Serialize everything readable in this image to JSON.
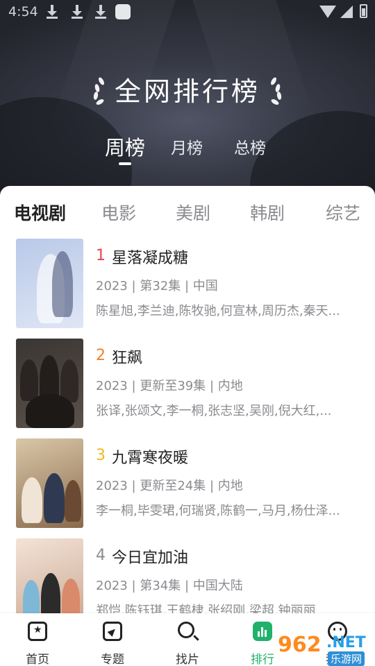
{
  "status_bar": {
    "time": "4:54"
  },
  "header": {
    "title": "全网排行榜",
    "period_tabs": [
      {
        "label": "周榜",
        "active": true
      },
      {
        "label": "月榜",
        "active": false
      },
      {
        "label": "总榜",
        "active": false
      }
    ]
  },
  "category_tabs": [
    {
      "label": "电视剧",
      "active": true
    },
    {
      "label": "电影",
      "active": false
    },
    {
      "label": "美剧",
      "active": false
    },
    {
      "label": "韩剧",
      "active": false
    },
    {
      "label": "综艺",
      "active": false
    }
  ],
  "items": [
    {
      "rank": "1",
      "rank_color": "#e8434a",
      "title": "星落凝成糖",
      "meta": "2023 | 第32集 | 中国",
      "cast": "陈星旭,李兰迪,陈牧驰,何宣林,周历杰,秦天...",
      "poster_colors": [
        "#b9c9e8",
        "#dfe6f5"
      ]
    },
    {
      "rank": "2",
      "rank_color": "#f0822c",
      "title": "狂飙",
      "meta": "2023 | 更新至39集 | 内地",
      "cast": "张译,张颂文,李一桐,张志坚,吴刚,倪大红,...",
      "poster_colors": [
        "#3a3633",
        "#5b514a"
      ]
    },
    {
      "rank": "3",
      "rank_color": "#f4b81c",
      "title": "九霄寒夜暖",
      "meta": "2023 | 更新至24集 | 内地",
      "cast": "李一桐,毕雯珺,何瑞贤,陈鹤一,马月,杨仕泽...",
      "poster_colors": [
        "#d9c7a8",
        "#8a6a4c"
      ]
    },
    {
      "rank": "4",
      "rank_color": "#8a8b8f",
      "title": "今日宜加油",
      "meta": "2023 | 第34集 | 中国大陆",
      "cast": "郑恺,陈钰琪,王鹤棣,张绍刚,梁超,钟丽丽",
      "poster_colors": [
        "#f3e3d8",
        "#c9a68f"
      ]
    }
  ],
  "bottom_nav": [
    {
      "label": "首页",
      "icon": "home-icon",
      "active": false
    },
    {
      "label": "专题",
      "icon": "topic-icon",
      "active": false
    },
    {
      "label": "找片",
      "icon": "search-icon",
      "active": false
    },
    {
      "label": "排行",
      "icon": "ranking-icon",
      "active": true
    },
    {
      "label": "我的",
      "icon": "profile-icon",
      "active": false
    }
  ],
  "watermark": {
    "num": "962",
    "suffix": ".NET",
    "text": "乐游网"
  },
  "colors": {
    "accent": "#20b26b",
    "header_bg": "#373a46"
  }
}
